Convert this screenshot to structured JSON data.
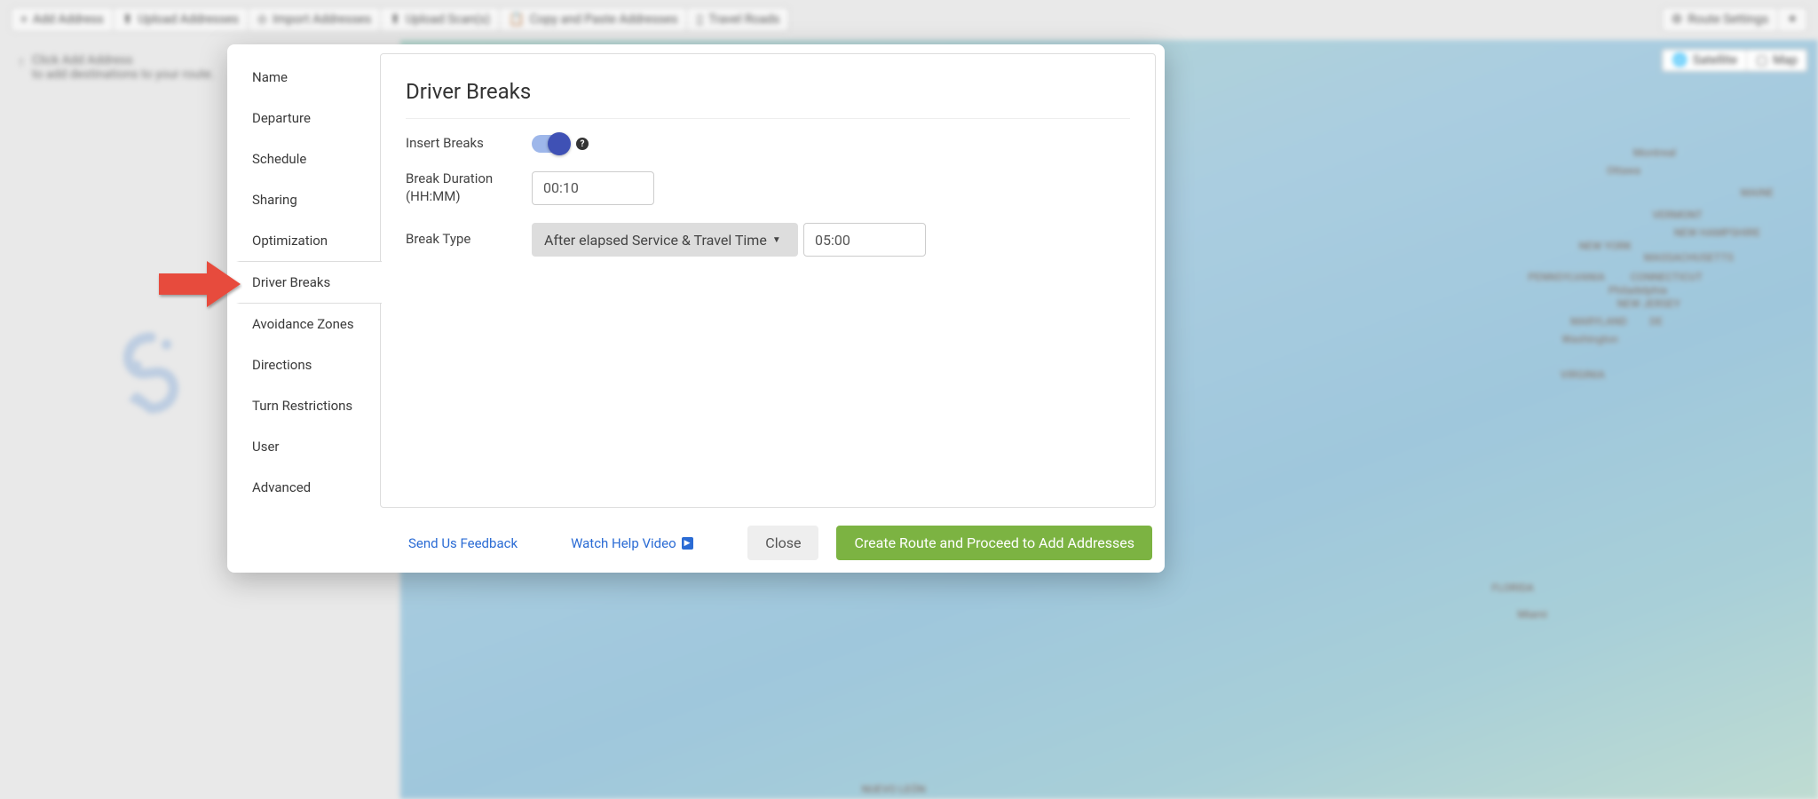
{
  "toolbar": {
    "add_address": "Add Address",
    "upload_addresses": "Upload Addresses",
    "import_addresses": "Import Addresses",
    "upload_scans": "Upload Scan(s)",
    "copy_paste": "Copy and Paste Addresses",
    "travel_roads": "Travel Roads",
    "route_settings": "Route Settings"
  },
  "hint": {
    "line1": "Click Add Address",
    "line2": "to add destinations to your route."
  },
  "map": {
    "satellite": "Satellite",
    "map": "Map",
    "labels": [
      "Montreal",
      "Ottawa",
      "MAINE",
      "VERMONT",
      "NEW HAMPSHIRE",
      "NEW YORK",
      "MASSACHUSETTS",
      "CONNECTICUT",
      "PENNSYLVANIA",
      "Philadelphia",
      "NEW JERSEY",
      "MARYLAND",
      "DE",
      "Washington",
      "VIRGINIA",
      "FLORIDA",
      "Miami",
      "NUEVO LEÓN"
    ]
  },
  "modal": {
    "sidebar": {
      "items": [
        {
          "label": "Name"
        },
        {
          "label": "Departure"
        },
        {
          "label": "Schedule"
        },
        {
          "label": "Sharing"
        },
        {
          "label": "Optimization"
        },
        {
          "label": "Driver Breaks"
        },
        {
          "label": "Avoidance Zones"
        },
        {
          "label": "Directions"
        },
        {
          "label": "Turn Restrictions"
        },
        {
          "label": "User"
        },
        {
          "label": "Advanced"
        }
      ],
      "active_index": 5
    },
    "content": {
      "title": "Driver Breaks",
      "insert_breaks_label": "Insert Breaks",
      "insert_breaks_on": true,
      "break_duration_label": "Break Duration (HH:MM)",
      "break_duration_value": "00:10",
      "break_type_label": "Break Type",
      "break_type_selected": "After elapsed Service & Travel Time",
      "break_type_time_value": "05:00"
    },
    "footer": {
      "feedback": "Send Us Feedback",
      "help_video": "Watch Help Video",
      "close": "Close",
      "create": "Create Route and Proceed to Add Addresses"
    }
  }
}
